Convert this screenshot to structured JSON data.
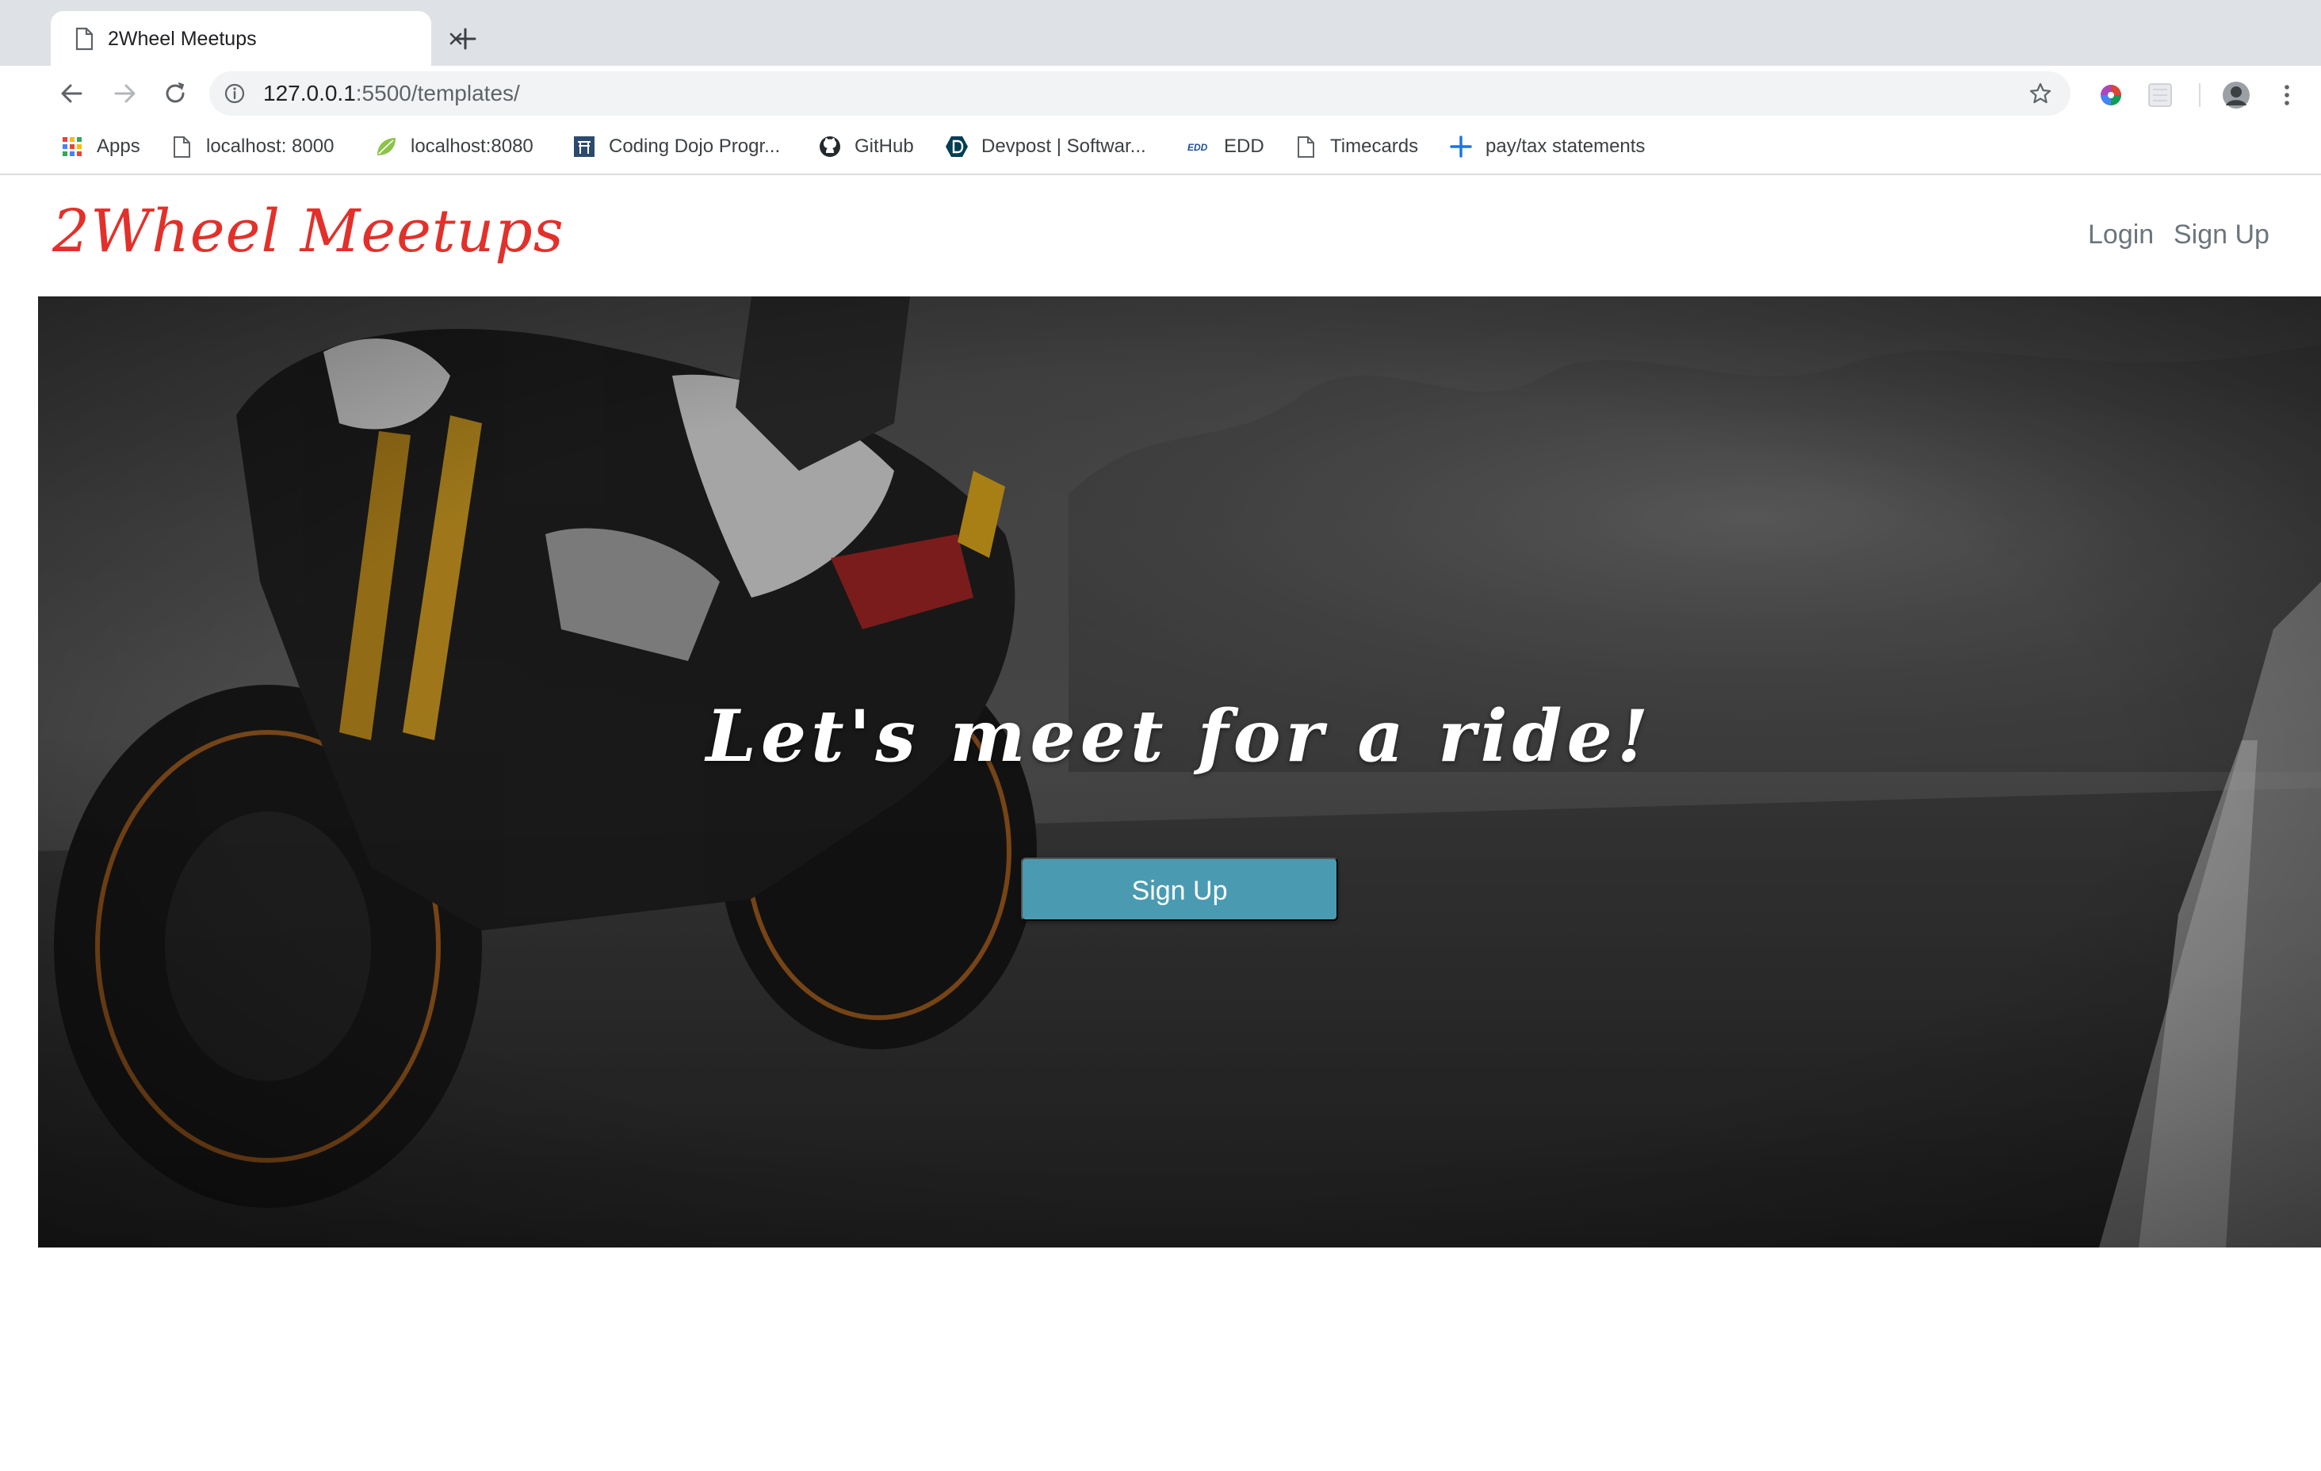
{
  "browser": {
    "tab_title": "2Wheel Meetups",
    "url_host": "127.0.0.1",
    "url_path": ":5500/templates/"
  },
  "bookmarks": [
    {
      "label": "Apps",
      "icon": "apps-grid-icon"
    },
    {
      "label": "localhost: 8000",
      "icon": "page-icon"
    },
    {
      "label": "localhost:8080",
      "icon": "spring-leaf-icon"
    },
    {
      "label": "Coding Dojo Progr...",
      "icon": "coding-dojo-icon"
    },
    {
      "label": "GitHub",
      "icon": "github-icon"
    },
    {
      "label": "Devpost | Softwar...",
      "icon": "devpost-icon"
    },
    {
      "label": "EDD",
      "icon": "edd-icon"
    },
    {
      "label": "Timecards",
      "icon": "page-icon"
    },
    {
      "label": "pay/tax statements",
      "icon": "plus-icon"
    }
  ],
  "navbar": {
    "brand": "2Wheel Meetups",
    "login": "Login",
    "signup": "Sign Up"
  },
  "hero": {
    "tagline": "Let's meet for a ride!",
    "cta": "Sign Up"
  },
  "colors": {
    "brand": "#e3302a",
    "cta": "#4a9bb1",
    "nav_link": "#6c757d"
  }
}
